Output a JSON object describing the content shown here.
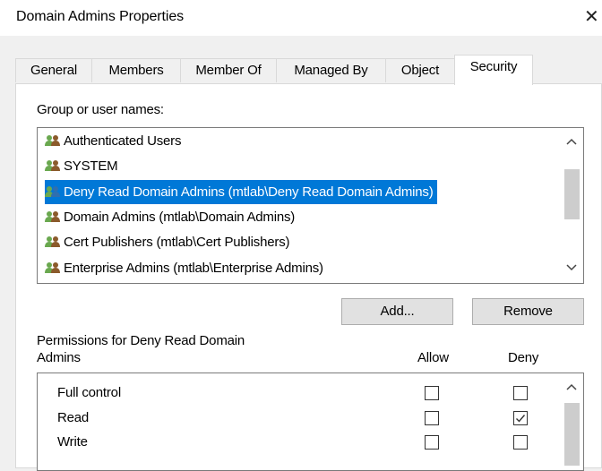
{
  "window": {
    "title": "Domain Admins Properties",
    "close_glyph": "✕"
  },
  "tabs": [
    {
      "label": "General"
    },
    {
      "label": "Members"
    },
    {
      "label": "Member Of"
    },
    {
      "label": "Managed By"
    },
    {
      "label": "Object"
    },
    {
      "label": "Security",
      "active": true
    }
  ],
  "security": {
    "group_label": "Group or user names:",
    "principals": [
      {
        "label": "Authenticated Users",
        "icon": "users-icon"
      },
      {
        "label": "SYSTEM",
        "icon": "users-icon"
      },
      {
        "label": "Deny Read Domain Admins (mtlab\\Deny Read Domain Admins)",
        "icon": "users-icon",
        "selected": true
      },
      {
        "label": "Domain Admins (mtlab\\Domain Admins)",
        "icon": "users-icon"
      },
      {
        "label": "Cert Publishers (mtlab\\Cert Publishers)",
        "icon": "users-icon"
      },
      {
        "label": "Enterprise Admins (mtlab\\Enterprise Admins)",
        "icon": "users-icon"
      }
    ],
    "add_label": "Add...",
    "remove_label": "Remove",
    "perm_label_line1": "Permissions for Deny Read Domain",
    "perm_label_line2": "Admins",
    "allow_label": "Allow",
    "deny_label": "Deny",
    "permissions": [
      {
        "name": "Full control",
        "allow": false,
        "deny": false
      },
      {
        "name": "Read",
        "allow": false,
        "deny": true
      },
      {
        "name": "Write",
        "allow": false,
        "deny": false
      }
    ]
  },
  "colors": {
    "selection": "#0078d7",
    "user_icon_green": "#6aa84f",
    "user_icon_brown": "#a0522d"
  }
}
